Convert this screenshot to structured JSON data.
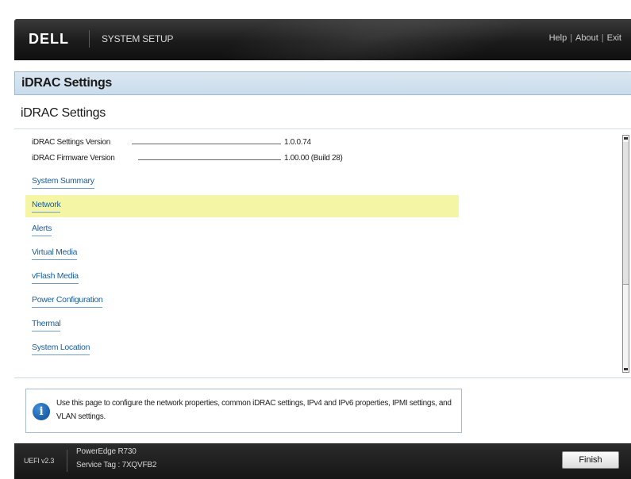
{
  "header": {
    "brand": "DELL",
    "app_title": "SYSTEM SETUP",
    "links": [
      "Help",
      "About",
      "Exit"
    ],
    "link_separator": "|"
  },
  "page": {
    "title": "iDRAC Settings",
    "section_title": "iDRAC Settings"
  },
  "info": [
    {
      "label": "iDRAC Settings Version",
      "value": "1.0.0.74"
    },
    {
      "label": "iDRAC Firmware Version",
      "value": "1.00.00 (Build 28)"
    }
  ],
  "menu": {
    "selected_index": 1,
    "items": [
      {
        "label": "System Summary"
      },
      {
        "label": "Network"
      },
      {
        "label": "Alerts"
      },
      {
        "label": "Virtual Media"
      },
      {
        "label": "vFlash Media"
      },
      {
        "label": "Power Configuration"
      },
      {
        "label": "Thermal"
      },
      {
        "label": "System Location"
      }
    ]
  },
  "help": {
    "icon": "info-icon",
    "glyph": "i",
    "text": "Use this page to configure the network properties, common iDRAC settings, IPv4 and IPv6 properties, IPMI settings, and VLAN settings."
  },
  "footer": {
    "uefi": "UEFI v2.3",
    "model": "PowerEdge R730",
    "service_tag": "Service Tag : 7XQVFB2",
    "finish_label": "Finish"
  },
  "colors": {
    "topbar": "#1b1b1b",
    "header_band": "#c9dceb",
    "selected_row": "#f4f6a6",
    "link": "#1a5fa0"
  }
}
